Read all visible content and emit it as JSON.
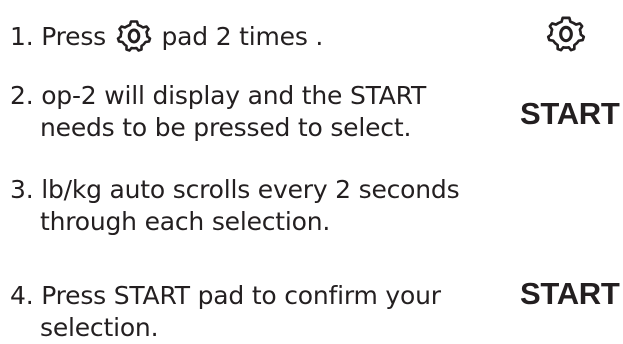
{
  "steps": [
    {
      "number": "1.",
      "text_before_icon": "Press",
      "icon": "gear-o-pad-icon",
      "text_after_icon": "pad 2 times ."
    },
    {
      "number": "2.",
      "line1": "op-2 will display and the START",
      "line2": "needs to be pressed to select."
    },
    {
      "number": "3.",
      "line1": "lb/kg auto scrolls every 2 seconds",
      "line2": "through each selection."
    },
    {
      "number": "4.",
      "line1": "Press START pad to confirm your",
      "line2": "selection."
    }
  ],
  "side_labels": {
    "step1_icon": "gear-o-pad-icon",
    "step2": "START",
    "step4": "START"
  },
  "colors": {
    "text": "#231f20",
    "background": "#ffffff"
  }
}
